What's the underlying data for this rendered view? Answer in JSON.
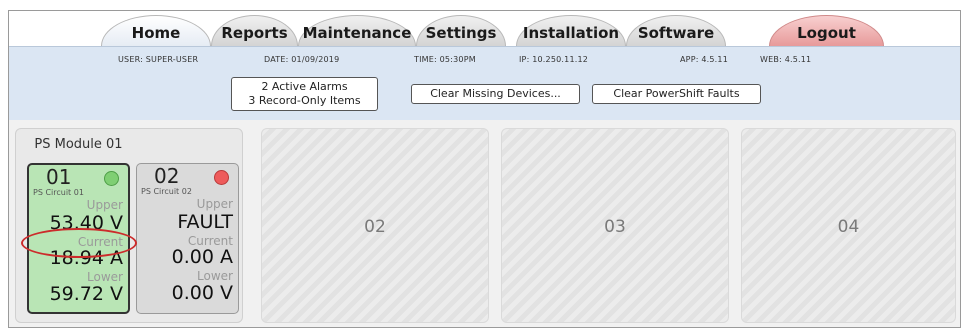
{
  "tabs": [
    {
      "label": "Home",
      "active": true
    },
    {
      "label": "Reports"
    },
    {
      "label": "Maintenance"
    },
    {
      "label": "Settings"
    },
    {
      "label": "Installation"
    },
    {
      "label": "Software"
    },
    {
      "label": "Logout"
    }
  ],
  "status": {
    "user": "USER: SUPER-USER",
    "date": "DATE: 01/09/2019",
    "time": "TIME: 05:30PM",
    "ip": "IP: 10.250.11.12",
    "app": "APP: 4.5.11",
    "web": "WEB: 4.5.11"
  },
  "alarms": {
    "line1": "2 Active Alarms",
    "line2": "3 Record-Only Items"
  },
  "buttons": {
    "clear_missing": "Clear Missing Devices...",
    "clear_faults": "Clear PowerShift Faults"
  },
  "module": {
    "title": "PS Module 01",
    "circuits": [
      {
        "num": "01",
        "name": "PS Circuit 01",
        "status": "green",
        "upper_label": "Upper",
        "upper_value": "53.40 V",
        "current_label": "Current",
        "current_value": "18.94 A",
        "lower_label": "Lower",
        "lower_value": "59.72 V"
      },
      {
        "num": "02",
        "name": "PS Circuit 02",
        "status": "red",
        "upper_label": "Upper",
        "upper_value": "FAULT",
        "current_label": "Current",
        "current_value": "0.00 A",
        "lower_label": "Lower",
        "lower_value": "0.00 V"
      }
    ]
  },
  "panels": [
    "02",
    "03",
    "04"
  ],
  "colors": {
    "status_ok": "#7fcf73",
    "status_fault": "#ee5b5b",
    "highlight": "#cc2b2b"
  }
}
